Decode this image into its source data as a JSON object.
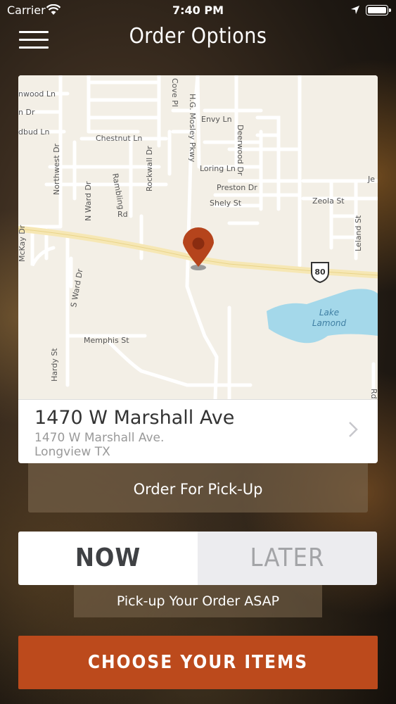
{
  "status_bar": {
    "carrier": "Carrier",
    "time": "7:40 PM"
  },
  "header": {
    "title": "Order Options",
    "menu_icon": "hamburger-menu-icon"
  },
  "map": {
    "labels": {
      "nwood": "nwood Ln",
      "dr": "n Dr",
      "dbud": "dbud Ln",
      "chestnut": "Chestnut Ln",
      "cove": "Cove Pl",
      "mosley": "H.G. Mosley Pkwy",
      "envy": "Envy Ln",
      "deerwood": "Deerwood Dr",
      "loring": "Loring Ln",
      "preston": "Preston Dr",
      "shely": "Shely St",
      "zeola": "Zeola St",
      "je": "Je",
      "northwest": "Northwest Dr",
      "nward": "N Ward Dr",
      "rambling": "Rambling",
      "rd": "Rd",
      "rockwall": "Rockwall Dr",
      "mckay": "McKay Dr",
      "sward": "S Ward Dr",
      "leland": "Leland St",
      "hwy": "80",
      "lake1": "Lake",
      "lake2": "Lamond",
      "memphis": "Memphis St",
      "hardy": "Hardy St",
      "rd2": "Rd"
    },
    "pin_icon": "map-pin-icon"
  },
  "address": {
    "title": "1470 W Marshall Ave",
    "line1": "1470 W Marshall Ave.",
    "line2": "Longview TX"
  },
  "pickup_label": "Order For Pick-Up",
  "timing": {
    "now": "NOW",
    "later": "LATER",
    "selected": "NOW"
  },
  "asap_label": "Pick-up Your Order ASAP",
  "choose_label": "CHOOSE YOUR ITEMS",
  "colors": {
    "accent": "#bc4a1c",
    "pin": "#b5441c",
    "water": "#a4d8ea"
  }
}
